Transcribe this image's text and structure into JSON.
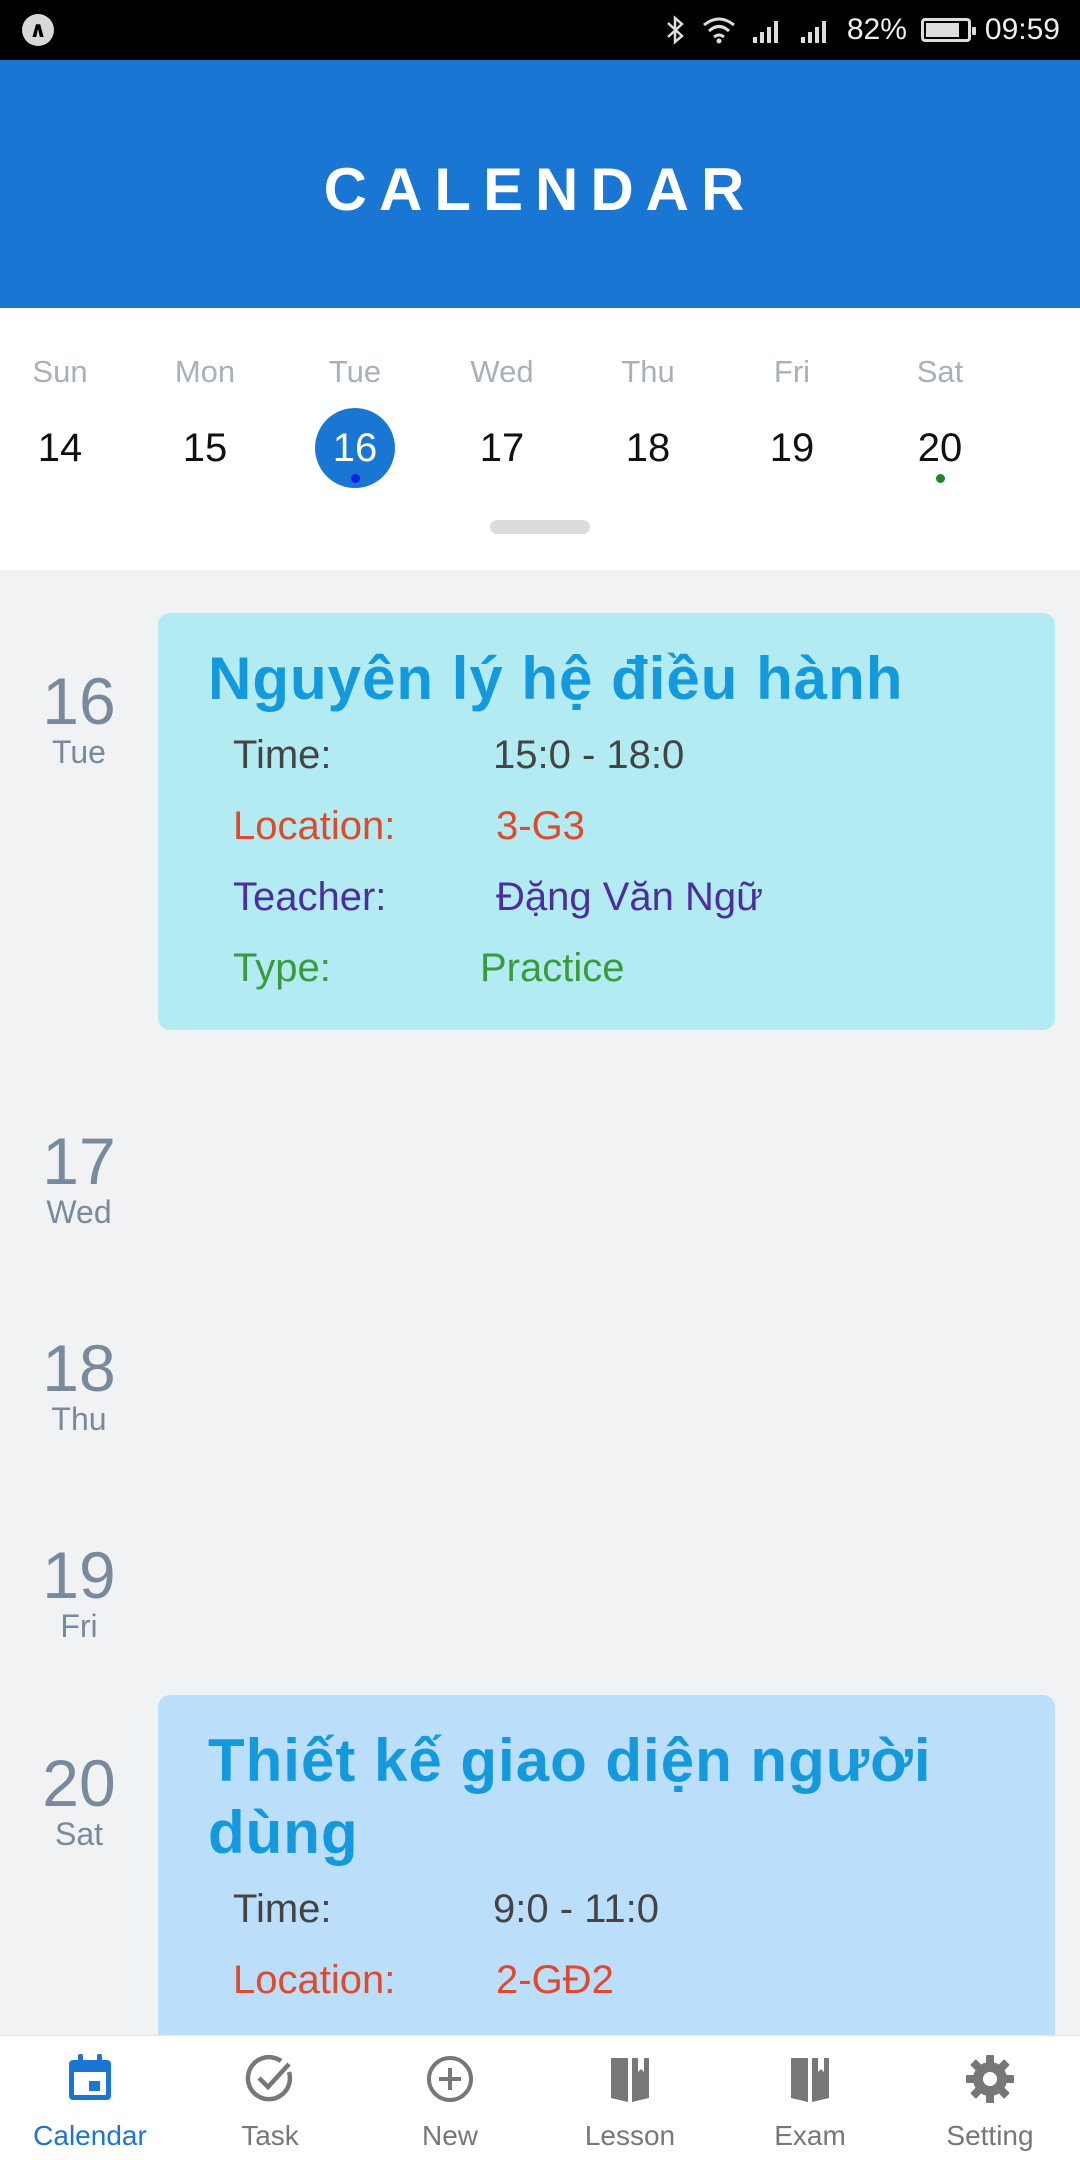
{
  "status_bar": {
    "battery": "82%",
    "battery_level": 0.82,
    "time": "09:59"
  },
  "header": {
    "title": "CALENDAR"
  },
  "week": [
    {
      "name": "Sun",
      "num": "14"
    },
    {
      "name": "Mon",
      "num": "15"
    },
    {
      "name": "Tue",
      "num": "16",
      "selected": true,
      "dot_color": "#0b24e6"
    },
    {
      "name": "Wed",
      "num": "17"
    },
    {
      "name": "Thu",
      "num": "18"
    },
    {
      "name": "Fri",
      "num": "19"
    },
    {
      "name": "Sat",
      "num": "20",
      "dot_color": "#1b8a2a"
    }
  ],
  "agenda": [
    {
      "num": "16",
      "day": "Tue",
      "event": {
        "title": "Nguyên lý hệ điều hành",
        "bg": "#b2ebf2",
        "time_label": "Time:",
        "time": "15:0 - 18:0",
        "location_label": "Location:",
        "location": "3-G3",
        "teacher_label": "Teacher:",
        "teacher": "Đặng Văn Ngữ",
        "type_label": "Type:",
        "type": "Practice"
      }
    },
    {
      "num": "17",
      "day": "Wed"
    },
    {
      "num": "18",
      "day": "Thu"
    },
    {
      "num": "19",
      "day": "Fri"
    },
    {
      "num": "20",
      "day": "Sat",
      "event": {
        "title": "Thiết kế giao diện người dùng",
        "bg": "#bbdefb",
        "time_label": "Time:",
        "time": "9:0 - 11:0",
        "location_label": "Location:",
        "location": "2-GĐ2"
      }
    }
  ],
  "bottom_nav": [
    {
      "label": "Calendar",
      "icon": "calendar-icon",
      "active": true
    },
    {
      "label": "Task",
      "icon": "check-circle-icon"
    },
    {
      "label": "New",
      "icon": "add-circle-icon"
    },
    {
      "label": "Lesson",
      "icon": "book-icon"
    },
    {
      "label": "Exam",
      "icon": "book-icon"
    },
    {
      "label": "Setting",
      "icon": "gear-icon"
    }
  ],
  "colors": {
    "primary": "#1976d2",
    "event_title": "#1499dd",
    "location": "#e0492a",
    "teacher": "#4e2e9e",
    "type": "#3a9a3e"
  }
}
